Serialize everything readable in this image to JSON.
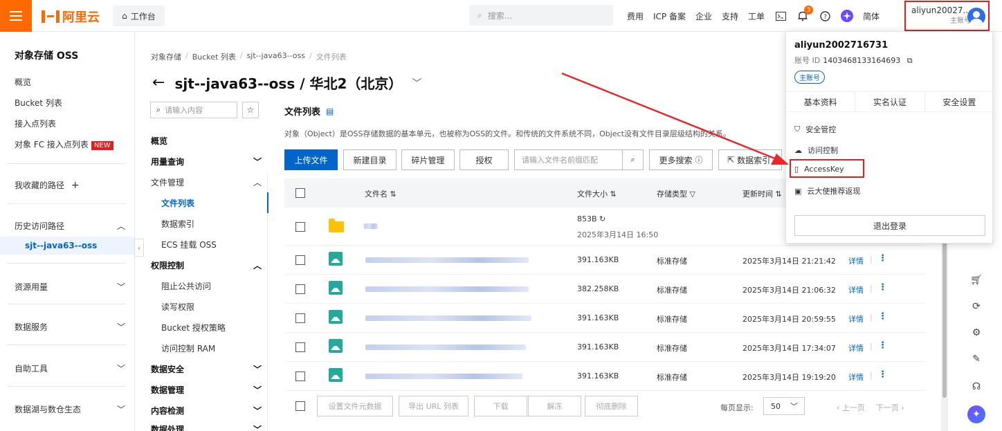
{
  "topbar": {
    "logo_text": "阿里云",
    "workbench_label": "工作台",
    "search_placeholder": "搜索...",
    "links": [
      "费用",
      "ICP 备案",
      "企业",
      "支持",
      "工单"
    ],
    "bell_badge": "3",
    "lang_label": "简体",
    "user_name": "aliyun20027...",
    "user_sub": "主账号",
    "icons": [
      "menu-icon",
      "home-icon",
      "search-icon",
      "terminal-icon",
      "bell-icon",
      "help-icon",
      "sparkle-icon",
      "avatar-icon"
    ]
  },
  "sidebar": {
    "title": "对象存储 OSS",
    "items": [
      "概览",
      "Bucket 列表",
      "接入点列表",
      "对象 FC 接入点列表"
    ],
    "new_badge": "NEW",
    "favorites_label": "我收藏的路径",
    "favorites_add": "+",
    "history_label": "历史访问路径",
    "history_active": "sjt--java63--oss",
    "groups": [
      "资源用量",
      "数据服务",
      "自助工具",
      "数据湖与数仓生态"
    ]
  },
  "breadcrumb": [
    "对象存储",
    "Bucket 列表",
    "sjt--java63--oss",
    "文件列表"
  ],
  "page_title": "sjt--java63--oss / 华北2（北京）",
  "nav2": {
    "search_placeholder": "请输入内容",
    "items": [
      {
        "label": "概览",
        "type": "bold"
      },
      {
        "label": "用量查询",
        "type": "bold",
        "caret": "⌄"
      },
      {
        "label": "文件管理",
        "type": "plain",
        "caret": "⌃"
      },
      {
        "label": "文件列表",
        "type": "active"
      },
      {
        "label": "数据索引",
        "type": "child"
      },
      {
        "label": "ECS 挂载 OSS",
        "type": "child"
      },
      {
        "label": "权限控制",
        "type": "bold",
        "caret": "⌃"
      },
      {
        "label": "阻止公共访问",
        "type": "child"
      },
      {
        "label": "读写权限",
        "type": "child"
      },
      {
        "label": "Bucket 授权策略",
        "type": "child"
      },
      {
        "label": "访问控制 RAM",
        "type": "child"
      },
      {
        "label": "数据安全",
        "type": "bold",
        "caret": "⌄"
      },
      {
        "label": "数据管理",
        "type": "bold",
        "caret": "⌄"
      },
      {
        "label": "内容检测",
        "type": "bold",
        "caret": "⌄"
      },
      {
        "label": "数据处理",
        "type": "bold",
        "caret": "⌄"
      }
    ]
  },
  "file_list": {
    "title": "文件列表",
    "description": "对象（Object）是OSS存储数据的基本单元，也被称为OSS的文件。和传统的文件系统不同，Object没有文件目录层级结构的关系。",
    "buttons": {
      "upload": "上传文件",
      "new_dir": "新建目录",
      "fragments": "碎片管理",
      "authorize": "授权",
      "search_placeholder": "请输入文件名前缀匹配",
      "more_search": "更多搜索",
      "data_index": "数据索引"
    },
    "columns": [
      "文件名",
      "文件大小",
      "存储类型",
      "更新时间"
    ],
    "folder_row": {
      "size": "853B",
      "time": "2025年3月14日 16:50"
    },
    "rows": [
      {
        "size": "391.163KB",
        "storage": "标准存储",
        "time": "2025年3月14日 21:21:42",
        "action": "详情"
      },
      {
        "size": "382.258KB",
        "storage": "标准存储",
        "time": "2025年3月14日 21:06:32",
        "action": "详情"
      },
      {
        "size": "391.163KB",
        "storage": "标准存储",
        "time": "2025年3月14日 20:59:55",
        "action": "详情"
      },
      {
        "size": "391.163KB",
        "storage": "标准存储",
        "time": "2025年3月14日 17:34:07",
        "action": "详情"
      },
      {
        "size": "391.163KB",
        "storage": "标准存储",
        "time": "2025年3月14日 19:19:20",
        "action": "详情"
      }
    ],
    "footer_buttons": [
      "设置文件元数据",
      "导出 URL 列表",
      "下载",
      "解冻",
      "彻底删除"
    ],
    "per_page_label": "每页显示:",
    "per_page_value": "50",
    "prev_label": "上一页",
    "next_label": "下一页"
  },
  "dropdown": {
    "username": "aliyun2002716731",
    "account_id_label": "账号 ID",
    "account_id": "1403468133164693",
    "tag": "主账号",
    "tabs": [
      "基本资料",
      "实名认证",
      "安全设置"
    ],
    "items": [
      "安全管控",
      "访问控制",
      "AccessKey",
      "云大使推荐返现"
    ],
    "logout": "退出登录"
  },
  "colors": {
    "accent": "#ff6a00",
    "primary": "#0064c8",
    "highlight": "#e02020"
  }
}
